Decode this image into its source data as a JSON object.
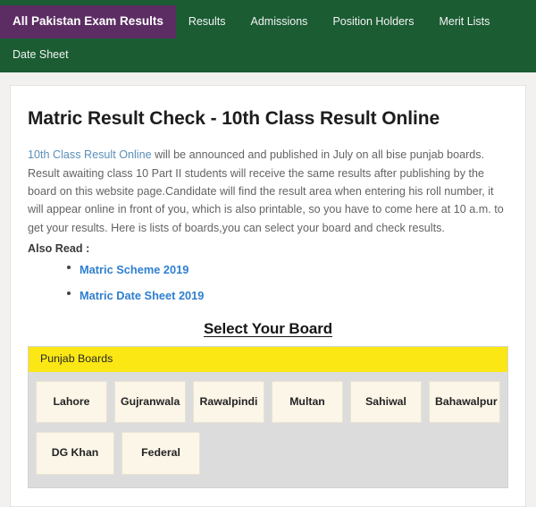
{
  "navbar": {
    "brand": "All Pakistan Exam Results",
    "brand_bg": "#5c2d63",
    "bar_bg": "#1b5c33",
    "links_row1": [
      "Results",
      "Admissions",
      "Position Holders",
      "Merit Lists"
    ],
    "links_row2": [
      "Date Sheet"
    ]
  },
  "main": {
    "title": "Matric Result Check - 10th Class Result Online",
    "intro_link": "10th Class Result Online",
    "intro_rest": " will be announced and published in July on all bise punjab boards. Result awaiting class 10 Part II students will receive the same results after publishing by the board on this website page.Candidate will find the result area when entering his roll number, it will appear online in front of you, which is also printable, so you have to come here at 10 a.m. to get your results. Here is lists of boards,you can select your board and check results.",
    "also_read_label": "Also Read :",
    "also_read_links": [
      "Matric Scheme 2019",
      "Matric Date Sheet 2019"
    ],
    "select_board_heading": "Select Your Board",
    "board_panel": {
      "header": "Punjab Boards",
      "header_bg": "#fbe713",
      "panel_bg": "#dcdcdc",
      "button_bg": "#fcf6e8",
      "rows": [
        [
          "Lahore",
          "Gujranwala",
          "Rawalpindi",
          "Multan",
          "Sahiwal",
          "Bahawalpur"
        ],
        [
          "DG Khan",
          "Federal"
        ]
      ]
    }
  }
}
